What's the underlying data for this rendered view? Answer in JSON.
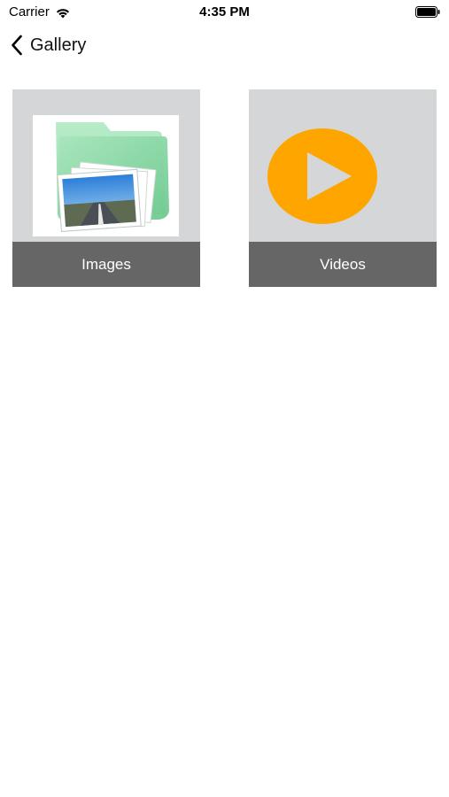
{
  "status_bar": {
    "carrier": "Carrier",
    "time": "4:35 PM",
    "wifi_icon": "wifi-icon",
    "battery_icon": "battery-icon"
  },
  "nav": {
    "back_label": "Gallery",
    "back_icon": "chevron-left-icon"
  },
  "tiles": [
    {
      "label": "Images",
      "icon": "image-folder-icon"
    },
    {
      "label": "Videos",
      "icon": "play-icon"
    }
  ],
  "colors": {
    "tile_background": "#d5d6d8",
    "caption_background": "#666666",
    "play_accent": "#ffa500"
  }
}
